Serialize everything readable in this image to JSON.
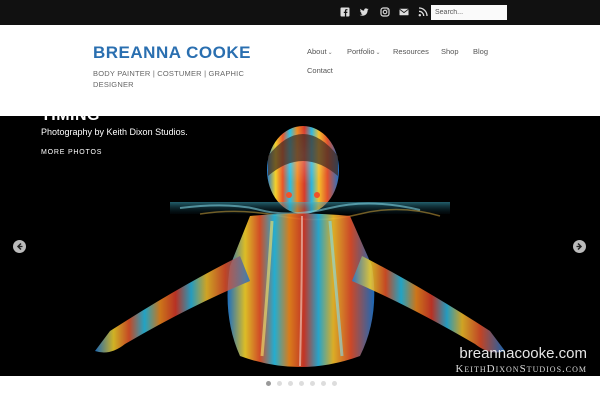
{
  "topbar": {
    "social": [
      {
        "icon": "facebook-icon"
      },
      {
        "icon": "twitter-icon"
      },
      {
        "icon": "instagram-icon"
      },
      {
        "icon": "email-icon"
      },
      {
        "icon": "rss-icon"
      }
    ],
    "search": {
      "placeholder": "Search..."
    }
  },
  "header": {
    "title": "BREANNA COOKE",
    "tagline": "BODY PAINTER | COSTUMER | GRAPHIC DESIGNER",
    "nav": {
      "about": "About",
      "portfolio": "Portfolio",
      "resources": "Resources",
      "shop": "Shop",
      "blog": "Blog",
      "contact": "Contact"
    }
  },
  "slide": {
    "title": "TIMING",
    "caption": "Photography by Keith Dixon Studios.",
    "link": "MORE PHOTOS",
    "watermark_site": "breannacooke.com",
    "watermark_studio": "KeithDixonStudios.com"
  },
  "slider_dots": {
    "count": 7,
    "active_index": 0
  },
  "colors": {
    "accent": "#2a6fb0",
    "topbar": "#111111"
  }
}
